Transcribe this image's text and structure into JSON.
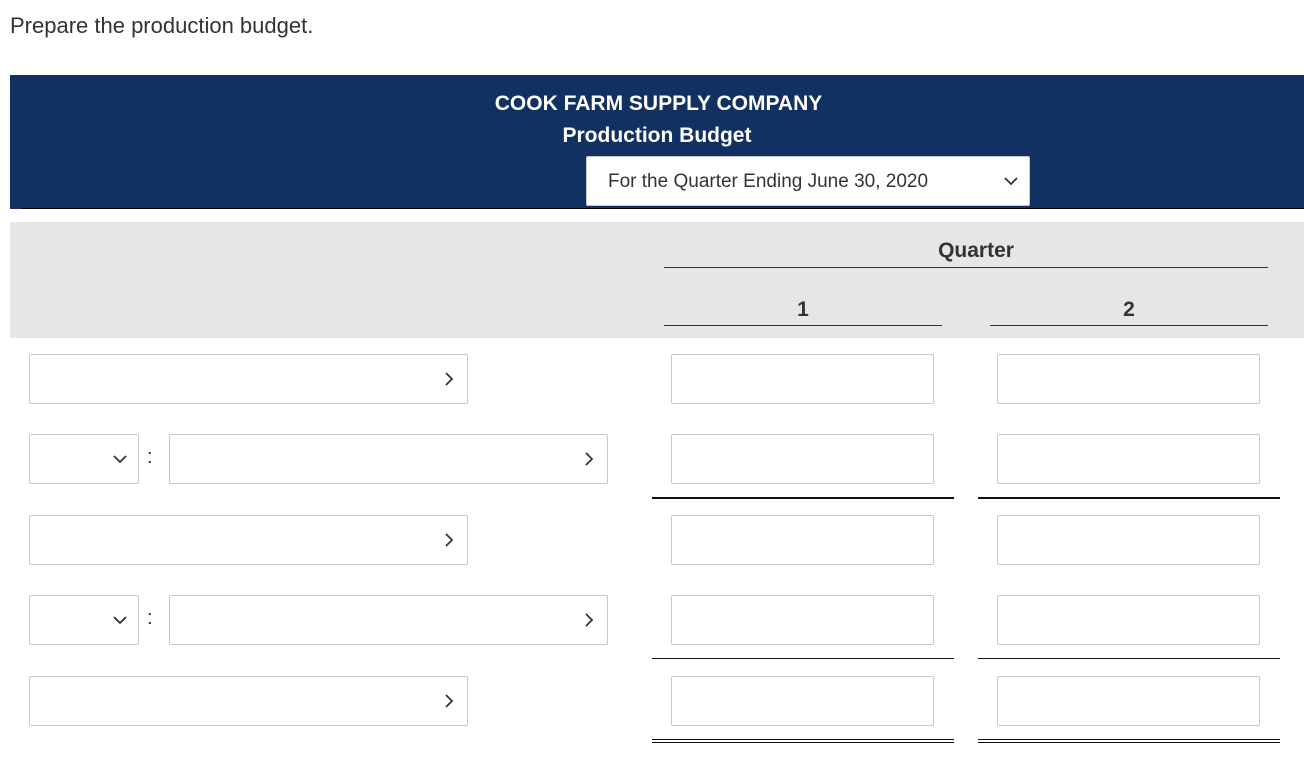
{
  "instruction": "Prepare the production budget.",
  "header": {
    "company": "COOK FARM SUPPLY COMPANY",
    "title": "Production Budget",
    "period_select": {
      "selected": "For the Quarter Ending June 30, 2020"
    }
  },
  "columns": {
    "group_label": "Quarter",
    "labels": [
      "1",
      "2"
    ]
  },
  "rows": [
    {
      "label_select": {
        "selected": ""
      },
      "values": [
        "",
        ""
      ]
    },
    {
      "prefix_select": {
        "selected": ""
      },
      "separator": ":",
      "label_select": {
        "selected": ""
      },
      "values": [
        "",
        ""
      ]
    },
    {
      "label_select": {
        "selected": ""
      },
      "values": [
        "",
        ""
      ]
    },
    {
      "prefix_select": {
        "selected": ""
      },
      "separator": ":",
      "label_select": {
        "selected": ""
      },
      "values": [
        "",
        ""
      ]
    },
    {
      "label_select": {
        "selected": ""
      },
      "values": [
        "",
        ""
      ]
    }
  ],
  "icons": {
    "dropdown": "chevron-down-icon",
    "row_dropdown": "chevron-right-icon"
  }
}
